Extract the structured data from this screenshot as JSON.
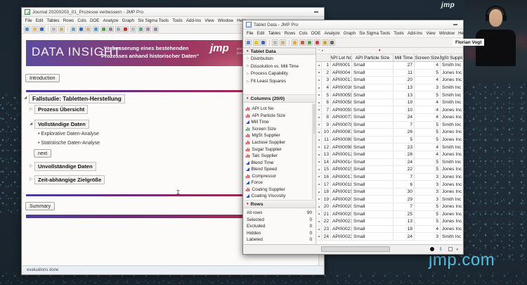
{
  "background": {
    "jmp_logo": "jmp",
    "jmp_com": "jmp.com"
  },
  "webcam": {
    "name": "Florian Vogt"
  },
  "journal_window": {
    "title": "Journal 20200203_01_Prozesse verbessern - JMP Pro",
    "menu": [
      "File",
      "Edit",
      "Tables",
      "Rows",
      "Cols",
      "DOE",
      "Analyze",
      "Graph",
      "Six Sigma Tools",
      "Tools",
      "Add-Ins",
      "View",
      "Window",
      "Help"
    ],
    "toolbar_icons": [
      "new-icon",
      "open-icon",
      "save-icon",
      "copy-icon",
      "paste-icon",
      "zoom-icon",
      "help-icon",
      "hand-icon",
      "globe-icon",
      "refresh-icon",
      "arrow-cursor-icon",
      "magnifier-icon",
      "plus-icon",
      "window-icon",
      "table-icon",
      "oval-icon",
      "shape-icon"
    ],
    "banner": {
      "title": "DATA INSIGHT",
      "subtitle_line1": "„Verbesserung eines bestehenden",
      "subtitle_line2": "Prozesses anhand historischer Daten“",
      "logo": "jmp",
      "tagline_line1": "STATISTICAL",
      "tagline_line2": "DISCOVERY."
    },
    "intro_button": "Introduction",
    "outline": {
      "item1": "Fallstudie: Tabletten-Herstellung",
      "item2": "Prozess Übersicht",
      "item3": "Vollständige Daten",
      "sub1": "Explorative Daten-Analyse",
      "sub2": "Statistische Daten-Analyse",
      "next_button": "next",
      "item4": "Unvollständige Daten",
      "item5": "Zeit-abhängige Zielgröße",
      "summary_button": "Summary"
    },
    "status": "evaluations done"
  },
  "table_window": {
    "title": "Tablet Data - JMP Pro",
    "menu": [
      "File",
      "Edit",
      "Tables",
      "Rows",
      "Cols",
      "DOE",
      "Analyze",
      "Graph",
      "Six Sigma Tools",
      "Tools",
      "Add-Ins",
      "View",
      "Window",
      "Help"
    ],
    "toolbar_icons": [
      "new-icon",
      "open-icon",
      "save-icon",
      "copy-icon",
      "paste-icon",
      "open-folder-icon",
      "journal-icon",
      "layout-icon",
      "run-icon",
      "flag-icon",
      "last-icon"
    ],
    "sidebar": {
      "panel_table": {
        "title": "Tablet Data",
        "items": [
          "Distribution",
          "Dissolution vs. Mill Time",
          "Process Capability",
          "Fit Least Squares"
        ]
      },
      "panel_columns": {
        "title": "Columns (20/0)",
        "items": [
          {
            "label": "API Lot No",
            "type": "nominal"
          },
          {
            "label": "API Particle Size",
            "type": "nominal"
          },
          {
            "label": "Mill Time",
            "type": "continuous"
          },
          {
            "label": "Screen Size",
            "type": "ordinal"
          },
          {
            "label": "MgSt Supplier",
            "type": "nominal"
          },
          {
            "label": "Lactose Supplier",
            "type": "nominal"
          },
          {
            "label": "Sugar Supplier",
            "type": "nominal"
          },
          {
            "label": "Talc Supplier",
            "type": "nominal"
          },
          {
            "label": "Blend Time",
            "type": "continuous"
          },
          {
            "label": "Blend Speed",
            "type": "continuous"
          },
          {
            "label": "Compressor",
            "type": "nominal"
          },
          {
            "label": "Force",
            "type": "continuous"
          },
          {
            "label": "Coating Supplier",
            "type": "nominal"
          },
          {
            "label": "Coating Viscosity",
            "type": "continuous"
          }
        ]
      },
      "panel_rows": {
        "title": "Rows",
        "stats": [
          {
            "label": "All rows",
            "value": "90"
          },
          {
            "label": "Selected",
            "value": "0"
          },
          {
            "label": "Excluded",
            "value": "0"
          },
          {
            "label": "Hidden",
            "value": "0"
          },
          {
            "label": "Labeled",
            "value": "0"
          }
        ]
      }
    },
    "table": {
      "columns": [
        "API Lot No",
        "API Particle Size",
        "Mill Time",
        "Screen Size",
        "MgSt Supplier"
      ],
      "rows": [
        [
          1,
          "API0001",
          "Small",
          27,
          4,
          "Smith Inc"
        ],
        [
          2,
          "API0004",
          "Small",
          11,
          5,
          "Jones Inc"
        ],
        [
          3,
          "API00017",
          "Small",
          20,
          4,
          "Jones Inc"
        ],
        [
          4,
          "API00036",
          "Small",
          13,
          3,
          "Smith Inc"
        ],
        [
          5,
          "API00055",
          "Small",
          13,
          5,
          "Smith Inc"
        ],
        [
          6,
          "API00058",
          "Small",
          19,
          4,
          "Smith Inc"
        ],
        [
          7,
          "API00059",
          "Small",
          10,
          4,
          "Jones Inc"
        ],
        [
          8,
          "API00073",
          "Small",
          24,
          4,
          "Jones Inc"
        ],
        [
          9,
          "API00078",
          "Small",
          7,
          5,
          "Smith Inc"
        ],
        [
          10,
          "API00087",
          "Small",
          26,
          5,
          "Jones Inc"
        ],
        [
          11,
          "API00089",
          "Small",
          5,
          5,
          "Jones Inc"
        ],
        [
          12,
          "API00098",
          "Small",
          23,
          4,
          "Smith Inc"
        ],
        [
          13,
          "API000122",
          "Small",
          28,
          4,
          "Jones Inc"
        ],
        [
          14,
          "API000147",
          "Small",
          24,
          5,
          "Smith Inc"
        ],
        [
          15,
          "API000154",
          "Small",
          22,
          5,
          "Jones Inc"
        ],
        [
          16,
          "API000173",
          "Small",
          7,
          3,
          "Jones Inc"
        ],
        [
          17,
          "API000181",
          "Small",
          6,
          3,
          "Jones Inc"
        ],
        [
          18,
          "API000198",
          "Small",
          30,
          3,
          "Jones Inc"
        ],
        [
          19,
          "API000200",
          "Small",
          29,
          3,
          "Smith Inc"
        ],
        [
          20,
          "API000202",
          "Small",
          7,
          5,
          "Jones Inc"
        ],
        [
          21,
          "API000203",
          "Small",
          25,
          5,
          "Jones Inc"
        ],
        [
          22,
          "API000213",
          "Small",
          13,
          5,
          "Jones Inc"
        ],
        [
          23,
          "API000216",
          "Small",
          18,
          4,
          "Jones Inc"
        ],
        [
          24,
          "API000236",
          "Small",
          24,
          3,
          "Smith Inc"
        ]
      ]
    }
  }
}
